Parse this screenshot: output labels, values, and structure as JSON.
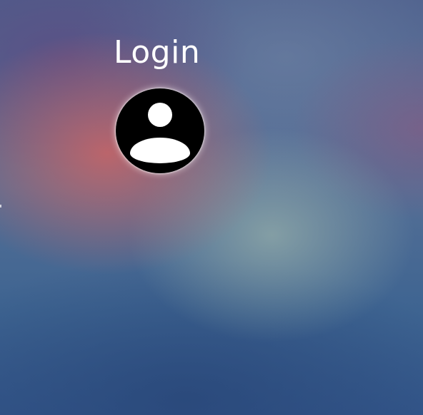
{
  "page": {
    "title": "Login"
  },
  "avatar": {
    "icon": "user-icon",
    "background_color": "#000000",
    "glyph_color": "#ffffff"
  }
}
